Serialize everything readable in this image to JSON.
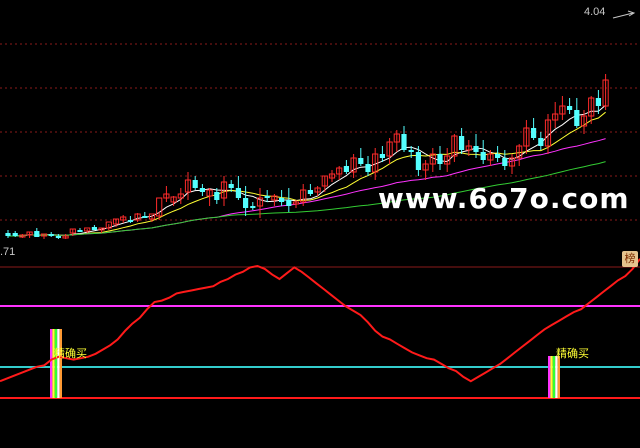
{
  "header": {
    "price_high": "4.04",
    "price_low": ".71"
  },
  "badge": {
    "label": "榜"
  },
  "watermark": {
    "text": "www.6o7o.com"
  },
  "indicator": {
    "buy_signals": [
      "精确买",
      "精确买"
    ]
  },
  "colors": {
    "bg": "#000000",
    "up": "#ff2b2b",
    "down": "#54ffff",
    "ma_short": "#ffffff",
    "ma_mid": "#ffff33",
    "ma_long": "#ff33ff",
    "ma_slow": "#33cc33",
    "osc_line": "#ff1a1a",
    "level_top": "#ff33ff",
    "level_mid": "#33cccc",
    "level_bot": "#ff1a1a",
    "grid": "#8a1a1a"
  },
  "chart_data": {
    "type": "candlestick",
    "candles": [
      {
        "o": 23,
        "h": 20,
        "l": 28,
        "c": 26
      },
      {
        "o": 23,
        "h": 21,
        "l": 27,
        "c": 26
      },
      {
        "o": 26,
        "h": 24,
        "l": 28,
        "c": 25
      },
      {
        "o": 25,
        "h": 22,
        "l": 28,
        "c": 22
      },
      {
        "o": 21,
        "h": 18,
        "l": 25,
        "c": 27
      },
      {
        "o": 26,
        "h": 24,
        "l": 29,
        "c": 24
      },
      {
        "o": 24,
        "h": 22,
        "l": 27,
        "c": 25
      },
      {
        "o": 26,
        "h": 24,
        "l": 29,
        "c": 27
      },
      {
        "o": 27,
        "h": 24,
        "l": 29,
        "c": 26
      },
      {
        "o": 23,
        "h": 19,
        "l": 26,
        "c": 19
      },
      {
        "o": 20,
        "h": 18,
        "l": 22,
        "c": 21
      },
      {
        "o": 21,
        "h": 19,
        "l": 23,
        "c": 18
      },
      {
        "o": 17,
        "h": 15,
        "l": 20,
        "c": 20
      },
      {
        "o": 20,
        "h": 18,
        "l": 23,
        "c": 18
      },
      {
        "o": 18,
        "h": 14,
        "l": 20,
        "c": 12
      },
      {
        "o": 14,
        "h": 9,
        "l": 17,
        "c": 9
      },
      {
        "o": 10,
        "h": 5,
        "l": 13,
        "c": 7
      },
      {
        "o": 10,
        "h": 6,
        "l": 13,
        "c": 10
      },
      {
        "o": 10,
        "h": 3,
        "l": 12,
        "c": 4
      },
      {
        "o": 6,
        "h": 2,
        "l": 8,
        "c": 6
      },
      {
        "o": 9,
        "h": 5,
        "l": 12,
        "c": 4
      },
      {
        "o": 6,
        "h": 2,
        "l": 10,
        "c": -12
      },
      {
        "o": -12,
        "h": -24,
        "l": -8,
        "c": -16
      },
      {
        "o": -8,
        "h": -14,
        "l": -4,
        "c": -13
      },
      {
        "o": -12,
        "h": -22,
        "l": -6,
        "c": -16
      },
      {
        "o": -18,
        "h": -38,
        "l": -10,
        "c": -30
      },
      {
        "o": -30,
        "h": -34,
        "l": -20,
        "c": -22
      },
      {
        "o": -22,
        "h": -26,
        "l": -14,
        "c": -18
      },
      {
        "o": -14,
        "h": -22,
        "l": -4,
        "c": -20
      },
      {
        "o": -18,
        "h": -22,
        "l": -6,
        "c": -10
      },
      {
        "o": -12,
        "h": -34,
        "l": -4,
        "c": -28
      },
      {
        "o": -26,
        "h": -30,
        "l": -18,
        "c": -22
      },
      {
        "o": -22,
        "h": -34,
        "l": -10,
        "c": -12
      },
      {
        "o": -12,
        "h": -24,
        "l": 6,
        "c": -2
      },
      {
        "o": -4,
        "h": -8,
        "l": 0,
        "c": -4
      },
      {
        "o": -4,
        "h": -22,
        "l": 8,
        "c": -12
      },
      {
        "o": -14,
        "h": -20,
        "l": -8,
        "c": -12
      },
      {
        "o": -10,
        "h": -16,
        "l": -4,
        "c": -14
      },
      {
        "o": -12,
        "h": -20,
        "l": -4,
        "c": -8
      },
      {
        "o": -10,
        "h": -22,
        "l": 2,
        "c": -4
      },
      {
        "o": -6,
        "h": -10,
        "l": -2,
        "c": -8
      },
      {
        "o": -8,
        "h": -26,
        "l": -4,
        "c": -20
      },
      {
        "o": -20,
        "h": -26,
        "l": -14,
        "c": -16
      },
      {
        "o": -18,
        "h": -24,
        "l": -14,
        "c": -22
      },
      {
        "o": -24,
        "h": -34,
        "l": -18,
        "c": -34
      },
      {
        "o": -32,
        "h": -40,
        "l": -28,
        "c": -36
      },
      {
        "o": -36,
        "h": -44,
        "l": -30,
        "c": -42
      },
      {
        "o": -44,
        "h": -50,
        "l": -36,
        "c": -38
      },
      {
        "o": -38,
        "h": -56,
        "l": -32,
        "c": -52
      },
      {
        "o": -52,
        "h": -62,
        "l": -44,
        "c": -46
      },
      {
        "o": -46,
        "h": -54,
        "l": -34,
        "c": -38
      },
      {
        "o": -38,
        "h": -62,
        "l": -30,
        "c": -56
      },
      {
        "o": -56,
        "h": -64,
        "l": -48,
        "c": -52
      },
      {
        "o": -54,
        "h": -72,
        "l": -46,
        "c": -68
      },
      {
        "o": -68,
        "h": -80,
        "l": -58,
        "c": -76
      },
      {
        "o": -76,
        "h": -84,
        "l": -58,
        "c": -60
      },
      {
        "o": -60,
        "h": -64,
        "l": -52,
        "c": -58
      },
      {
        "o": -58,
        "h": -64,
        "l": -34,
        "c": -40
      },
      {
        "o": -40,
        "h": -50,
        "l": -30,
        "c": -46
      },
      {
        "o": -46,
        "h": -62,
        "l": -38,
        "c": -56
      },
      {
        "o": -56,
        "h": -64,
        "l": -40,
        "c": -46
      },
      {
        "o": -46,
        "h": -62,
        "l": -38,
        "c": -54
      },
      {
        "o": -54,
        "h": -76,
        "l": -48,
        "c": -74
      },
      {
        "o": -74,
        "h": -82,
        "l": -56,
        "c": -60
      },
      {
        "o": -60,
        "h": -70,
        "l": -54,
        "c": -64
      },
      {
        "o": -64,
        "h": -76,
        "l": -52,
        "c": -58
      },
      {
        "o": -58,
        "h": -70,
        "l": -46,
        "c": -50
      },
      {
        "o": -50,
        "h": -60,
        "l": -44,
        "c": -56
      },
      {
        "o": -56,
        "h": -64,
        "l": -48,
        "c": -52
      },
      {
        "o": -52,
        "h": -60,
        "l": -40,
        "c": -44
      },
      {
        "o": -44,
        "h": -56,
        "l": -36,
        "c": -52
      },
      {
        "o": -52,
        "h": -66,
        "l": -44,
        "c": -64
      },
      {
        "o": -64,
        "h": -90,
        "l": -56,
        "c": -82
      },
      {
        "o": -82,
        "h": -92,
        "l": -70,
        "c": -72
      },
      {
        "o": -72,
        "h": -78,
        "l": -60,
        "c": -64
      },
      {
        "o": -64,
        "h": -96,
        "l": -56,
        "c": -90
      },
      {
        "o": -90,
        "h": -108,
        "l": -82,
        "c": -96
      },
      {
        "o": -96,
        "h": -114,
        "l": -90,
        "c": -104
      },
      {
        "o": -104,
        "h": -112,
        "l": -96,
        "c": -100
      },
      {
        "o": -100,
        "h": -112,
        "l": -82,
        "c": -84
      },
      {
        "o": -84,
        "h": -100,
        "l": -76,
        "c": -94
      },
      {
        "o": -94,
        "h": -114,
        "l": -86,
        "c": -112
      },
      {
        "o": -112,
        "h": -120,
        "l": -96,
        "c": -104
      },
      {
        "o": -104,
        "h": -136,
        "l": -100,
        "c": -130
      }
    ],
    "oscillator": [
      -40,
      -44,
      -48,
      -52,
      -56,
      -60,
      -62,
      -70,
      -74,
      -72,
      -70,
      -72,
      -74,
      -78,
      -84,
      -90,
      -98,
      -110,
      -120,
      -128,
      -140,
      -150,
      -152,
      -156,
      -162,
      -164,
      -166,
      -168,
      -170,
      -172,
      -178,
      -182,
      -188,
      -192,
      -198,
      -200,
      -196,
      -188,
      -182,
      -190,
      -198,
      -192,
      -184,
      -176,
      -168,
      -160,
      -152,
      -144,
      -138,
      -132,
      -122,
      -110,
      -102,
      -98,
      -92,
      -86,
      -80,
      -76,
      -72,
      -70,
      -64,
      -58,
      -54,
      -46,
      -40,
      -46,
      -52,
      -58,
      -64,
      -72,
      -80,
      -88,
      -96,
      -104,
      -112,
      -118,
      -124,
      -130,
      -136,
      -140,
      -148,
      -156,
      -164,
      -172,
      -180,
      -186,
      -196,
      -210
    ]
  }
}
